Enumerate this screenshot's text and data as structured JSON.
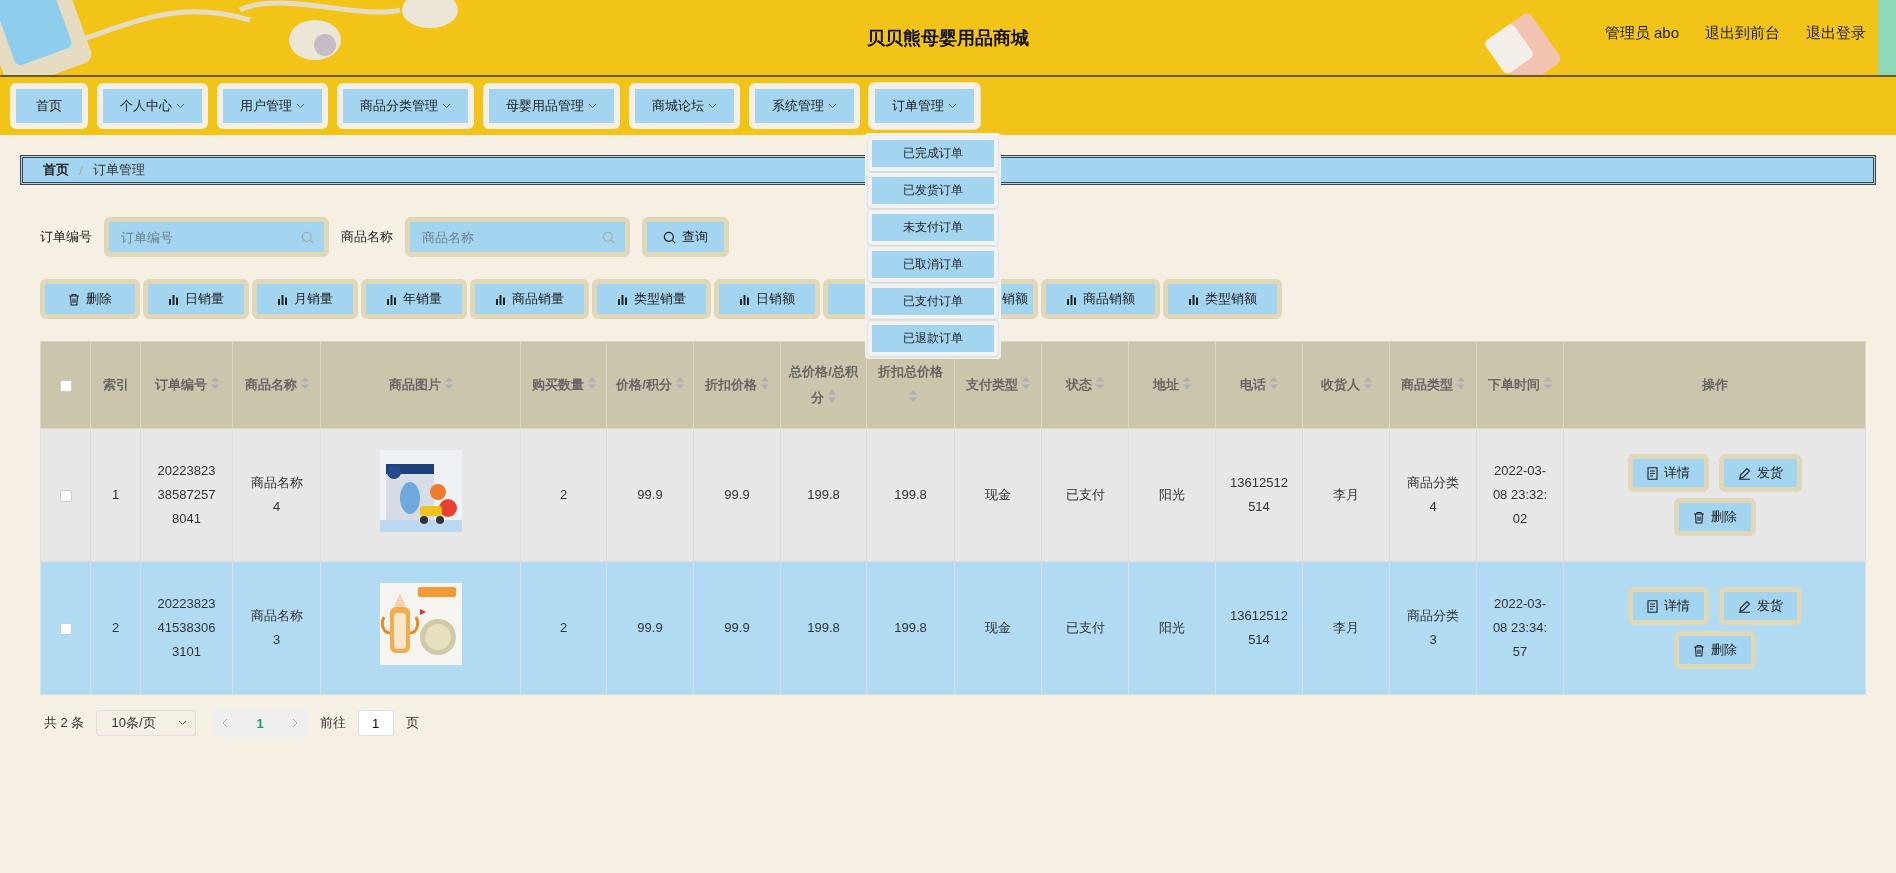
{
  "header": {
    "title": "贝贝熊母婴用品商城",
    "user": "管理员 abo",
    "links": [
      "退出到前台",
      "退出登录"
    ]
  },
  "nav": [
    {
      "label": "首页",
      "kind": "link",
      "expanded": false
    },
    {
      "label": "个人中心",
      "kind": "menu",
      "expanded": false
    },
    {
      "label": "用户管理",
      "kind": "menu",
      "expanded": false
    },
    {
      "label": "商品分类管理",
      "kind": "menu",
      "expanded": false
    },
    {
      "label": "母婴用品管理",
      "kind": "menu",
      "expanded": false
    },
    {
      "label": "商城论坛",
      "kind": "menu",
      "expanded": false
    },
    {
      "label": "系统管理",
      "kind": "menu",
      "expanded": false
    },
    {
      "label": "订单管理",
      "kind": "menu",
      "expanded": true,
      "items": [
        "已完成订单",
        "已发货订单",
        "未支付订单",
        "已取消订单",
        "已支付订单",
        "已退款订单"
      ]
    }
  ],
  "breadcrumb": {
    "items": [
      "首页",
      "订单管理"
    ],
    "separator": "/"
  },
  "search": [
    {
      "label": "订单编号",
      "placeholder": "订单编号"
    },
    {
      "label": "商品名称",
      "placeholder": "商品名称"
    }
  ],
  "search_button": "查询",
  "toolbar": [
    {
      "label": "删除",
      "kind": "delete"
    },
    {
      "label": "日销量",
      "kind": "chart"
    },
    {
      "label": "月销量",
      "kind": "chart"
    },
    {
      "label": "年销量",
      "kind": "chart"
    },
    {
      "label": "商品销量",
      "kind": "chart"
    },
    {
      "label": "类型销量",
      "kind": "chart"
    },
    {
      "label": "日销额",
      "kind": "chart"
    },
    {
      "kind": "chart"
    },
    {
      "label": "销额",
      "kind": "chart"
    },
    {
      "label": "商品销额",
      "kind": "chart"
    },
    {
      "label": "类型销额",
      "kind": "chart"
    }
  ],
  "table": {
    "columns": [
      {
        "label": "索引",
        "sortable": false
      },
      {
        "label": "订单编号",
        "sortable": true
      },
      {
        "label": "商品名称",
        "sortable": true
      },
      {
        "label": "商品图片",
        "sortable": true
      },
      {
        "label": "购买数量",
        "sortable": true
      },
      {
        "label": "价格/积分",
        "sortable": true
      },
      {
        "label": "折扣价格",
        "sortable": true
      },
      {
        "label": "总价格/总积分",
        "sortable": true
      },
      {
        "label": "折扣总价格",
        "sortable": true
      },
      {
        "label": "支付类型",
        "sortable": true
      },
      {
        "label": "状态",
        "sortable": true
      },
      {
        "label": "地址",
        "sortable": true
      },
      {
        "label": "电话",
        "sortable": true
      },
      {
        "label": "收货人",
        "sortable": true
      },
      {
        "label": "商品类型",
        "sortable": true
      },
      {
        "label": "下单时间",
        "sortable": true
      },
      {
        "label": "操作",
        "sortable": false
      }
    ],
    "header_checked": false,
    "rows": [
      {
        "checked": false,
        "selected": false,
        "cells": [
          "1",
          "20223823385872578041",
          "商品名称4",
          {
            "kind": "picture"
          },
          "2",
          "99.9",
          "99.9",
          "199.8",
          "199.8",
          "现金",
          "已支付",
          "阳光",
          "13612512514",
          "李月",
          "商品分类4",
          "2022-03-08 23:32:02"
        ],
        "actions": [
          {
            "label": "详情",
            "kind": "detail"
          },
          {
            "label": "发货",
            "kind": "ship"
          },
          {
            "label": "删除",
            "kind": "delete"
          }
        ]
      },
      {
        "checked": false,
        "selected": true,
        "cells": [
          "2",
          "20223823415383063101",
          "商品名称3",
          {
            "kind": "picture"
          },
          "2",
          "99.9",
          "99.9",
          "199.8",
          "199.8",
          "现金",
          "已支付",
          "阳光",
          "13612512514",
          "李月",
          "商品分类3",
          "2022-03-08 23:34:57"
        ],
        "actions": [
          {
            "label": "详情",
            "kind": "detail"
          },
          {
            "label": "发货",
            "kind": "ship"
          },
          {
            "label": "删除",
            "kind": "delete"
          }
        ]
      }
    ]
  },
  "pagination": {
    "total": "共 2 条",
    "page_size": "10条/页",
    "pages": [
      {
        "label": "1",
        "selected": true
      }
    ],
    "goto_label": "前往",
    "goto_value": "1",
    "goto_suffix": "页"
  }
}
